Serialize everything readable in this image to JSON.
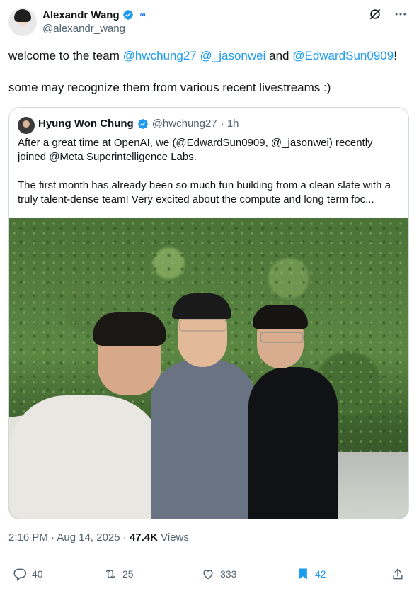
{
  "author": {
    "name": "Alexandr Wang",
    "handle": "@alexandr_wang"
  },
  "tweet": {
    "line1_text": "welcome to the team ",
    "mention1": "@hwchung27",
    "mention2": "@_jasonwei",
    "and_text": " and ",
    "mention3": "@EdwardSun0909",
    "line1_end": "!",
    "line2": "some may recognize them from various recent livestreams :)"
  },
  "quote": {
    "name": "Hyung Won Chung",
    "handle": "@hwchung27",
    "time": "· 1h",
    "para1": "After a great time at OpenAI, we (@EdwardSun0909, @_jasonwei) recently joined @Meta Superintelligence Labs.",
    "para2": "The first month has already been so much fun building from a clean slate with a truly talent-dense team! Very excited about the compute and long term foc..."
  },
  "timestamp": "2:16 PM · Aug 14, 2025 · ",
  "views_count": "47.4K",
  "views_label": " Views",
  "actions": {
    "replies": "40",
    "reposts": "25",
    "likes": "333",
    "bookmarks": "42"
  },
  "colors": {
    "link": "#1d9bf0",
    "muted": "#536471",
    "text": "#0f1419"
  },
  "icons": [
    "verified-badge-icon",
    "meta-affiliate-icon",
    "grok-icon",
    "more-icon",
    "reply-icon",
    "repost-icon",
    "like-icon",
    "bookmark-icon",
    "share-icon"
  ]
}
